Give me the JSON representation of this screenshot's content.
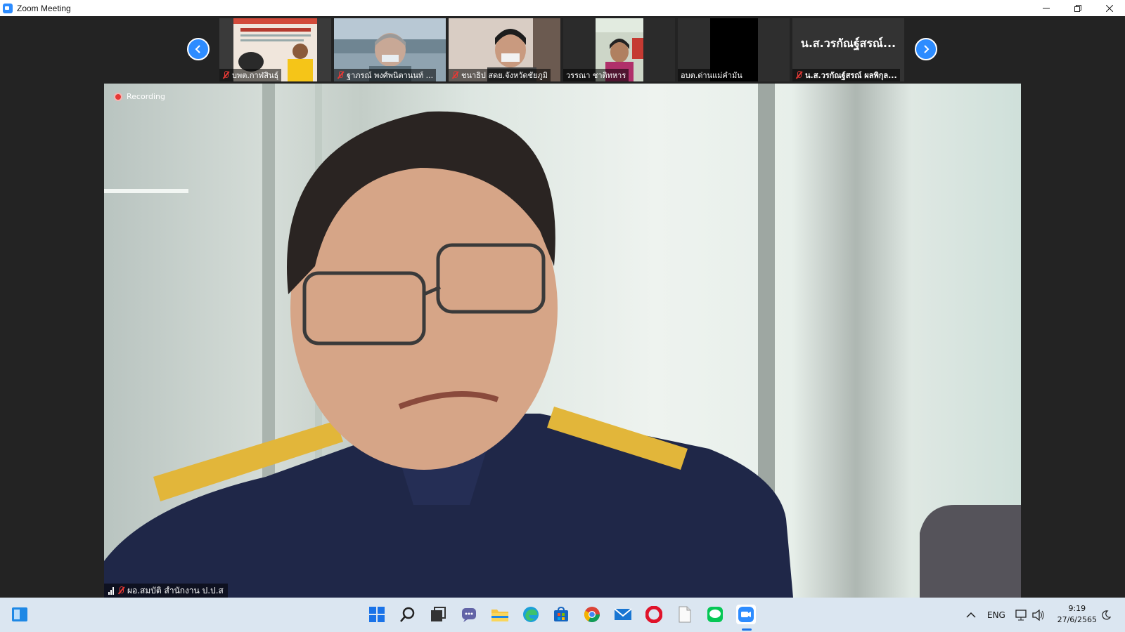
{
  "window": {
    "title": "Zoom Meeting"
  },
  "gallery": {
    "thumbnails": [
      {
        "name": "บพต.กาฬสินธุ์",
        "muted": true
      },
      {
        "name": "ฐาภรณ์ พงศ์พนิตานนท์ ...",
        "muted": true
      },
      {
        "name": "ชนาธิป สดย.จังหวัดชัยภูมิ",
        "muted": true
      },
      {
        "name": "วรรณา ชาติทหาร",
        "muted": false
      },
      {
        "name": "อบต.ด่านแม่คำมัน",
        "muted": false
      },
      {
        "name": "น.ส.วรกัณฐ์สรณ์ ผลพิกุล...",
        "muted": true,
        "display_name": "น.ส.วรกัณฐ์สรณ์..."
      }
    ]
  },
  "main": {
    "recording_label": "Recording",
    "speaker_name": "ผอ.สมบัติ สำนักงาน ป.ป.ส"
  },
  "taskbar": {
    "language": "ENG",
    "time": "9:19",
    "date": "27/6/2565"
  },
  "colors": {
    "zoom_blue": "#2d8cff",
    "muted_red": "#e53935"
  }
}
